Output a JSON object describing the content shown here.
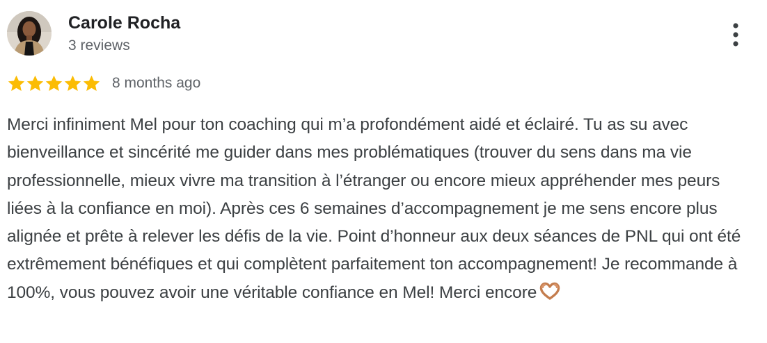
{
  "review": {
    "author": {
      "name": "Carole Rocha",
      "meta": "3 reviews",
      "avatar_icon": "profile-photo"
    },
    "more_icon": "more-vert-icon",
    "rating": {
      "stars": 5,
      "max_stars": 5,
      "star_color": "#fbbc04",
      "date": "8 months ago"
    },
    "text": "Merci infiniment Mel pour ton coaching qui m’a profondément aidé et éclairé. Tu as su avec bienveillance et sincérité me guider dans mes problématiques (trouver du sens dans ma vie professionnelle, mieux vivre ma transition à l’étranger ou encore mieux appréhender mes peurs liées à la confiance en moi). Après ces 6 semaines d’accompagnement je me sens encore plus alignée et prête à relever les défis de la vie. Point d’honneur aux deux séances de PNL qui ont été extrêmement bénéfiques et qui complètent parfaitement ton accompagnement! Je recommande à 100%, vous pouvez avoir une véritable confiance en Mel! Merci encore",
    "trailing_emoji_icon": "heart-hands-emoji"
  }
}
